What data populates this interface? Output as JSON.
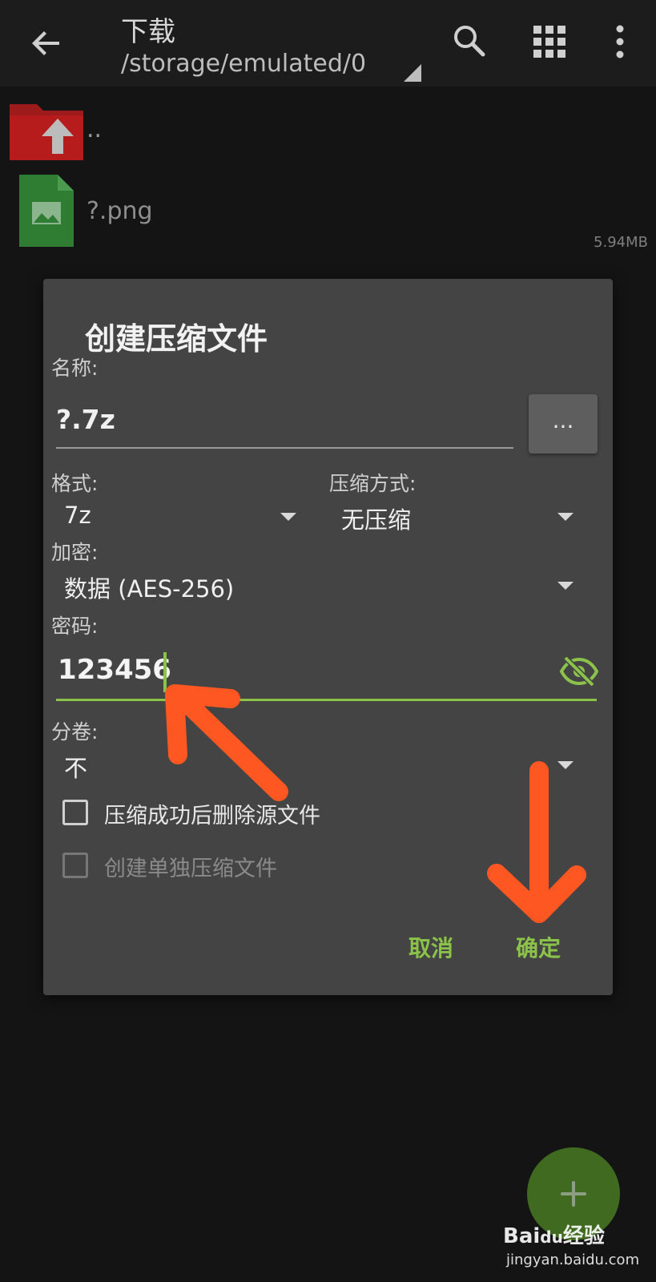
{
  "toolbar": {
    "title": "下载",
    "path": "/storage/emulated/0"
  },
  "files": [
    {
      "name": ".."
    },
    {
      "name": "?.png",
      "size": "5.94MB"
    }
  ],
  "dialog": {
    "title": "创建压缩文件",
    "name_label": "名称:",
    "name_value": "?.7z",
    "browse_label": "...",
    "format_label": "格式:",
    "format_value": "7z",
    "method_label": "压缩方式:",
    "method_value": "无压缩",
    "encrypt_label": "加密:",
    "encrypt_value": "数据 (AES-256)",
    "password_label": "密码:",
    "password_value": "123456",
    "split_label": "分卷:",
    "split_value": "不",
    "delete_source_label": "压缩成功后删除源文件",
    "separate_label": "创建单独压缩文件",
    "cancel_label": "取消",
    "ok_label": "确定"
  },
  "watermark": {
    "brand": "Bai",
    "brand2": "du",
    "brand3": "经验",
    "site": "jingyan.baidu.com"
  },
  "colors": {
    "accent": "#8bc34a",
    "annotation_arrow": "#ff5722",
    "dialog_bg": "#444444",
    "folder": "#b71c1c",
    "image_file": "#2e7d32"
  },
  "icons": [
    "arrow-left-icon",
    "search-icon",
    "grid-icon",
    "more-vert-icon",
    "folder-up-icon",
    "image-file-icon",
    "eye-off-icon",
    "plus-icon"
  ]
}
